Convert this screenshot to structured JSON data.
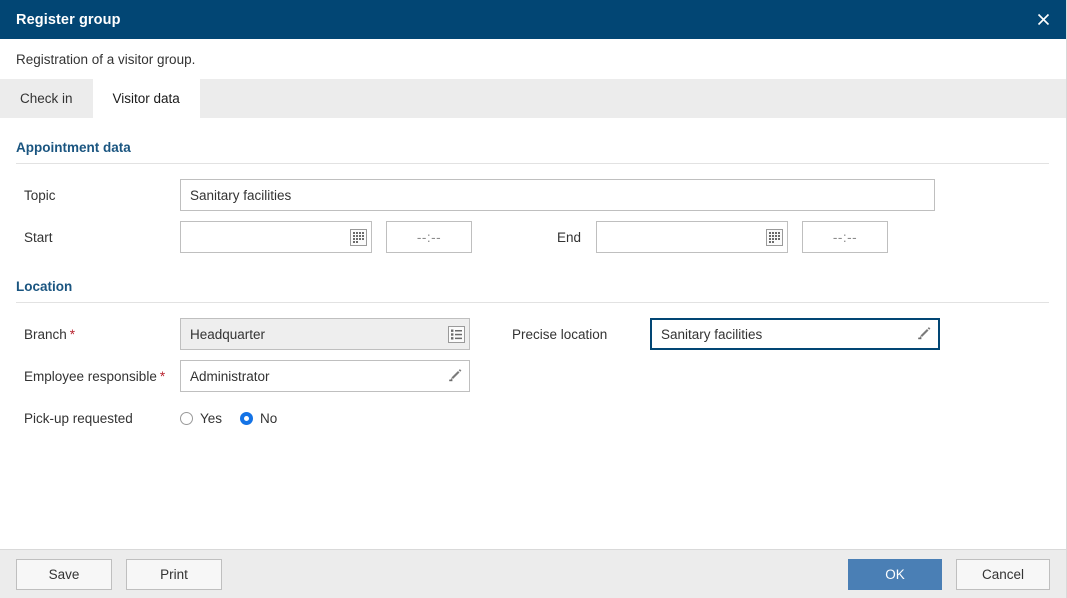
{
  "window": {
    "title": "Register group",
    "close_icon": "close-icon",
    "subtitle": "Registration of a visitor group."
  },
  "tabs": [
    {
      "label": "Check in",
      "active": false
    },
    {
      "label": "Visitor data",
      "active": true
    }
  ],
  "sections": {
    "appointment": {
      "title": "Appointment data",
      "topic": {
        "label": "Topic",
        "value": "Sanitary facilities",
        "placeholder": ""
      },
      "start": {
        "label": "Start",
        "date_value": "",
        "date_placeholder": "",
        "date_icon": "calendar-icon",
        "time_value": "--:--"
      },
      "end": {
        "label": "End",
        "date_value": "",
        "date_placeholder": "",
        "date_icon": "calendar-icon",
        "time_value": "--:--"
      }
    },
    "location": {
      "title": "Location",
      "branch": {
        "label": "Branch",
        "required_marker": "*",
        "value": "Headquarter",
        "icon": "list-select-icon",
        "readonly": true
      },
      "precise_location": {
        "label": "Precise location",
        "value": "Sanitary facilities",
        "icon": "pencil-icon",
        "focused": true
      },
      "employee_responsible": {
        "label": "Employee responsible",
        "required_marker": "*",
        "value": "Administrator",
        "icon": "pencil-icon"
      },
      "pickup": {
        "label": "Pick-up requested",
        "options": [
          {
            "label": "Yes",
            "selected": false
          },
          {
            "label": "No",
            "selected": true
          }
        ]
      }
    }
  },
  "footer": {
    "save_label": "Save",
    "print_label": "Print",
    "ok_label": "OK",
    "cancel_label": "Cancel"
  },
  "colors": {
    "titlebar_blue": "#024674",
    "section_heading_blue": "#1a5580",
    "primary_button_blue": "#4a7fb5",
    "focus_border_blue": "#024674",
    "radio_selected_blue": "#1473e6",
    "required_red": "#b8232f",
    "tabstrip_gray": "#ececec",
    "readonly_field_gray": "#eeeeee"
  }
}
